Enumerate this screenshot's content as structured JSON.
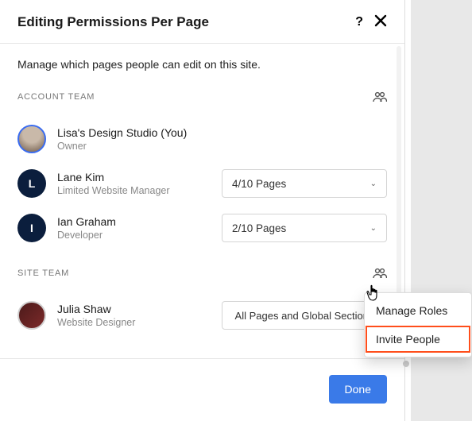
{
  "modal": {
    "title": "Editing Permissions Per Page",
    "description": "Manage which pages people can edit on this site."
  },
  "sections": {
    "account_team": {
      "label": "ACCOUNT TEAM",
      "members": [
        {
          "name": "Lisa's Design Studio (You)",
          "role": "Owner"
        },
        {
          "name": "Lane Kim",
          "role": "Limited Website Manager",
          "pages": "4/10 Pages",
          "initial": "L"
        },
        {
          "name": "Ian Graham",
          "role": "Developer",
          "pages": "2/10 Pages",
          "initial": "I"
        }
      ]
    },
    "site_team": {
      "label": "SITE TEAM",
      "members": [
        {
          "name": "Julia Shaw",
          "role": "Website Designer",
          "pages": "All Pages and Global Sections"
        }
      ]
    }
  },
  "popover": {
    "items": [
      {
        "label": "Manage Roles"
      },
      {
        "label": "Invite People",
        "highlighted": true
      }
    ]
  },
  "footer": {
    "done": "Done"
  }
}
